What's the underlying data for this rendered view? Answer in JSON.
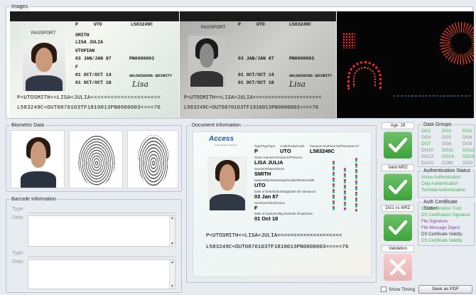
{
  "groups": {
    "images": "Images",
    "biometric": "Biometric Data",
    "barcode": "Barcode Information",
    "document": "Document Information",
    "data_groups": "Data Groups",
    "auth_status": "Authentication Status",
    "auth_cert_status": "Auth Certificate Status"
  },
  "passport": {
    "heading": "PASSPORT",
    "type_label": "Type",
    "type": "P",
    "code": "UTO",
    "number": "L583249C",
    "surname": "SMITH",
    "given_names": "LISA JULIA",
    "nationality": "UTOPIAN",
    "dob": "03 JAN/JAN 87",
    "personal_no": "PN0000003",
    "sex": "F",
    "issue_date": "01 OCT/OCT 14",
    "authority": "AKLOWIGGING SECURITY",
    "expiry": "01 OCT/OCT 18",
    "signature": "Lisa",
    "mrz1": "P<UTOSMITH<<LISA<JULIA<<<<<<<<<<<<<<<<<<<<<",
    "mrz2": "L583249C<OUT0870103TF1810013PN0000003<<<<76",
    "mrz1_ir": "P<UTOSMITH<<LISA<JULIA<<<<<<<<<<<<<<<<<<<<<<",
    "mrz2_ir": "L583249C<OUT0870103TF1810013PN0000003<<<<76"
  },
  "barcode": {
    "type_label": "Type:",
    "data_label": "Data:"
  },
  "document": {
    "logo": "Access",
    "logo_sub": "Smart Identity Solutions",
    "type_label": "Type/Typ/Type",
    "type": "P",
    "code_label": "Code/Kode/Code",
    "code": "UTO",
    "passport_label": "Passport No/Pass-Nr/Passeport N°",
    "passport_no": "L583249C",
    "given_label": "Given names/Vornamen/Prénoms",
    "given": "LISA JULIA",
    "surname_label": "Surname/Name/Nom",
    "surname": "SMITH",
    "nationality_label": "Nationality/Staatsangehörigkeit/Nationalité",
    "nationality": "UTO",
    "dob_label": "Date of birth/Geburtstag/Date de naissance",
    "dob": "03 Jan 87",
    "sex_label": "Sex/Geschlecht/Sexe",
    "sex": "F",
    "expiry_label": "Date of expiry/Gültig bis/Date d'expiration",
    "expiry": "01 Oct 18",
    "mrz1": "P<UTOSMITH<<LISA<JULIA<<<<<<<<<<<<<<<<<<<<",
    "mrz2": "L583249C<OUT0870103TF1810013PN0000003<<<<<76"
  },
  "status": {
    "age": "Age: 28",
    "valid_mrz": "Valid MRZ",
    "dg1_vs_mrz": "DG1 vs MRZ",
    "validation": "Validation"
  },
  "data_groups": [
    {
      "label": "DG1",
      "state": "ok"
    },
    {
      "label": "DG2",
      "state": "ok"
    },
    {
      "label": "DG3",
      "state": "ok"
    },
    {
      "label": "DG4",
      "state": "off"
    },
    {
      "label": "DG5",
      "state": "off"
    },
    {
      "label": "DG6",
      "state": "off"
    },
    {
      "label": "DG7",
      "state": "ok"
    },
    {
      "label": "DG8",
      "state": "off"
    },
    {
      "label": "DG9",
      "state": "off"
    },
    {
      "label": "DG10",
      "state": "off"
    },
    {
      "label": "DG11",
      "state": "ok"
    },
    {
      "label": "DG12",
      "state": "ok"
    },
    {
      "label": "DG13",
      "state": "off"
    },
    {
      "label": "DG14",
      "state": "ok"
    },
    {
      "label": "DG15",
      "state": "ok"
    },
    {
      "label": "DG16",
      "state": "off"
    },
    {
      "label": "COM",
      "state": "off"
    },
    {
      "label": "SOD",
      "state": "off"
    }
  ],
  "auth_status": [
    {
      "label": "Active Authentication",
      "state": "ok"
    },
    {
      "label": "Chip Authentication",
      "state": "ok"
    },
    {
      "label": "Terminal Authentication",
      "state": "ok"
    }
  ],
  "auth_cert": [
    {
      "label": "DS Certification Trust",
      "state": "ok"
    },
    {
      "label": "DS Certification Signature",
      "state": "ok"
    },
    {
      "label": "File Signature",
      "state": "warn"
    },
    {
      "label": "File Message Digest",
      "state": "warn"
    },
    {
      "label": "DS Certificate Validity",
      "state": "plain"
    },
    {
      "label": "CS Certificate Validity",
      "state": "ok"
    }
  ],
  "footer": {
    "show_timing": "Show Timing",
    "save_pdf": "Save as PDF"
  },
  "colors": {
    "ok": "#37b34a",
    "warn": "#8b3fb4",
    "off": "#888888",
    "plain": "#333333"
  }
}
